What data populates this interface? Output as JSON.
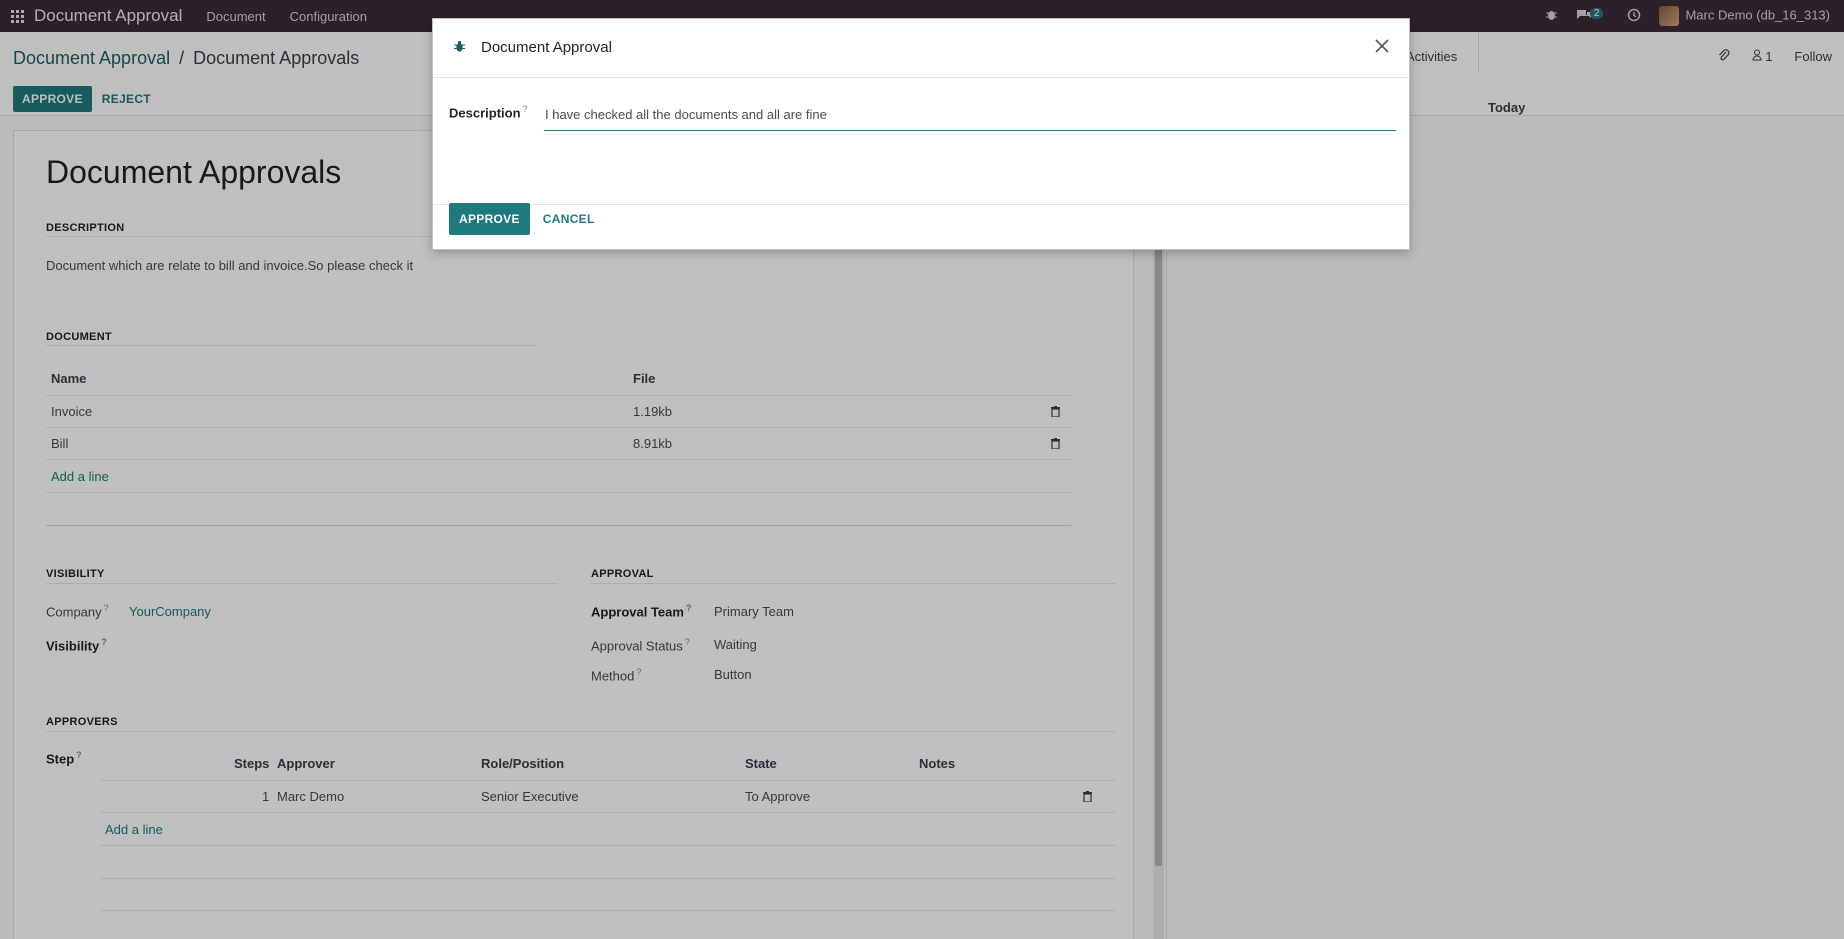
{
  "navbar": {
    "app_name": "Document Approval",
    "menu": [
      "Document",
      "Configuration"
    ],
    "message_count": "2",
    "user": "Marc Demo (db_16_313)"
  },
  "breadcrumb": {
    "parent": "Document Approval",
    "separator": "/",
    "current": "Document Approvals"
  },
  "statusbar": {
    "approve": "APPROVE",
    "reject": "REJECT"
  },
  "chatter": {
    "activities": "Activities",
    "followers": "1",
    "follow": "Follow",
    "today": "Today"
  },
  "form": {
    "title": "Document Approvals",
    "description_title": "DESCRIPTION",
    "description_text": "Document which are relate to bill and invoice.So please check it",
    "document_title": "DOCUMENT",
    "document_columns": [
      "Name",
      "File"
    ],
    "documents": [
      {
        "name": "Invoice",
        "file": "1.19kb"
      },
      {
        "name": "Bill",
        "file": "8.91kb"
      }
    ],
    "add_line": "Add a line",
    "visibility_title": "VISIBILITY",
    "company_label": "Company",
    "company_value": "YourCompany",
    "visibility_label": "Visibility",
    "approval_title": "APPROVAL",
    "approval_team_label": "Approval Team",
    "approval_team_value": "Primary Team",
    "approval_status_label": "Approval Status",
    "approval_status_value": "Waiting",
    "method_label": "Method",
    "method_value": "Button",
    "approvers_title": "APPROVERS",
    "step_label": "Step",
    "approver_columns": [
      "Steps",
      "Approver",
      "Role/Position",
      "State",
      "Notes"
    ],
    "approvers": [
      {
        "steps": "1",
        "approver": "Marc Demo",
        "role": "Senior Executive",
        "state": "To Approve",
        "notes": ""
      }
    ],
    "help_mark": "?"
  },
  "modal": {
    "title": "Document Approval",
    "description_label": "Description",
    "description_value": "I have checked all the documents and all are fine",
    "approve": "APPROVE",
    "cancel": "CANCEL"
  },
  "colors": {
    "navbar": "#3b2d38",
    "primary": "#1f7a7e"
  }
}
